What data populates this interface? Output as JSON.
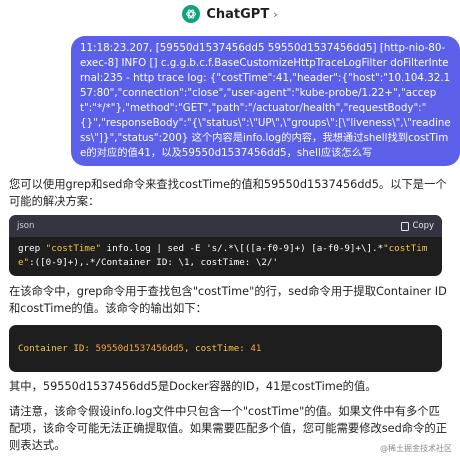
{
  "header": {
    "title": "ChatGPT",
    "chevron": "›"
  },
  "user_message": "11:18:23.207, [59550d1537456dd5 59550d1537456dd5] [http-nio-80-exec-8] INFO [] c.g.g.b.c.f.BaseCustomizeHttpTraceLogFilter doFilterInternal:235 - http trace log: {\"costTime\":41,\"header\":{\"host\":\"10.104.32.157:80\",\"connection\":\"close\",\"user-agent\":\"kube-probe/1.22+\",\"accept\":\"*/*\"},\"method\":\"GET\",\"path\":\"/actuator/health\",\"requestBody\":\"{}\",\"responseBody\":\"{\\\"status\\\":\\\"UP\\\",\\\"groups\\\":[\\\"liveness\\\",\\\"readiness\\\"]}\",\"status\":200} 这个内容是info.log的内容，我想通过shell找到costTime的对应的值41，以及59550d1537456dd5，shell应该怎么写",
  "answer": {
    "intro": "您可以使用grep和sed命令来查找costTime的值和59550d1537456dd5。以下是一个可能的解决方案：",
    "code1_lang": "json",
    "copy_label": "Copy",
    "code1_parts": {
      "a": "grep ",
      "b": "\"costTime\"",
      "c": " info.log | sed -E 's/.*\\[([a-f0-9]+) [a-f0-9]+\\].*",
      "d": "\"costTime\"",
      "e": ":([0-9]+),.*/Container ID: \\1, costTime: \\2/'"
    },
    "explain": "在该命令中，grep命令用于查找包含\"costTime\"的行，sed命令用于提取Container ID和costTime的值。该命令的输出如下：",
    "code2_parts": {
      "label": "Container ID: ",
      "id": "59550d1537456dd5",
      "mid": ", costTime: ",
      "val": "41"
    },
    "meaning": "其中，59550d1537456dd5是Docker容器的ID，41是costTime的值。",
    "note": "请注意，该命令假设info.log文件中只包含一个\"costTime\"的值。如果文件中有多个匹配项，该命令可能无法正确提取值。如果需要匹配多个值，您可能需要修改sed命令的正则表达式。"
  },
  "watermark": "@稀土掘金技术社区",
  "colors": {
    "user_bubble": "#5b60e8",
    "code_bg": "#1e1e1e",
    "code_header": "#343541",
    "string": "#f5c542",
    "brand": "#0fa37f"
  }
}
